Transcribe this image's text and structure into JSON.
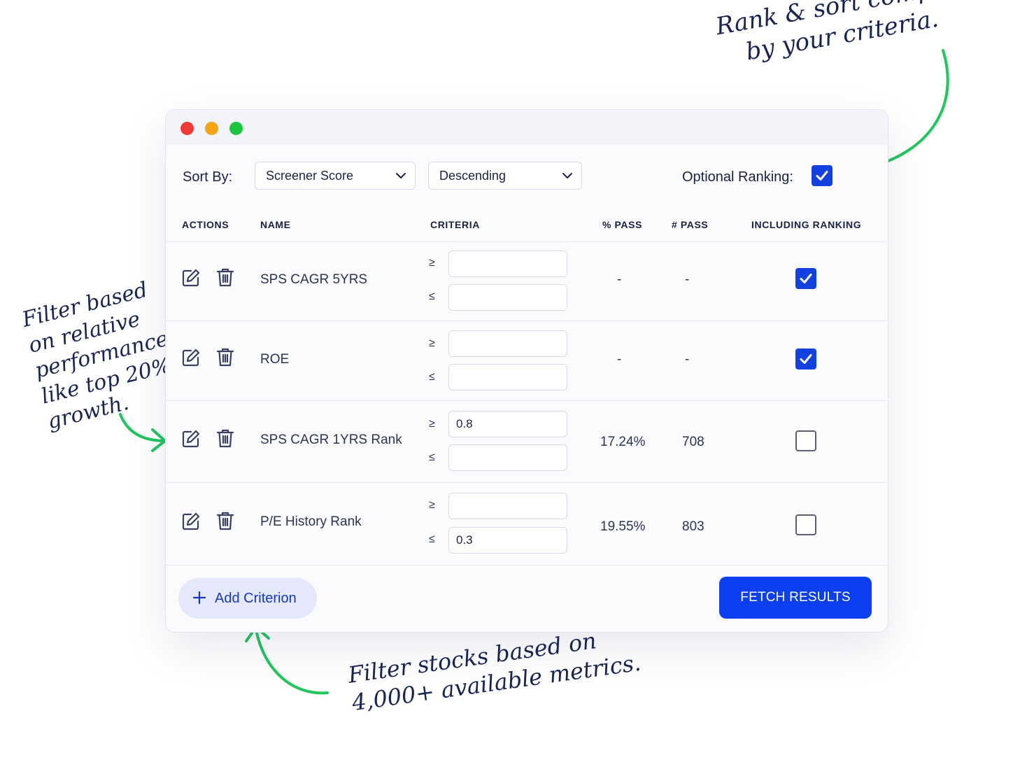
{
  "annotations": {
    "top_line1": "Rank & sort companies",
    "top_line2": "by your criteria.",
    "left_line1": "Filter based",
    "left_line2": "on relative",
    "left_line3": "performance,",
    "left_line4": "like top 20%",
    "left_line5": "growth.",
    "bottom_line1": "Filter stocks based on",
    "bottom_line2": "4,000+ available metrics."
  },
  "window": {
    "traffic_lights": {
      "close_color": "#ef3b35",
      "minimize_color": "#f6a417",
      "zoom_color": "#1ec53f"
    }
  },
  "sortbar": {
    "sort_label": "Sort By:",
    "sort_field": "Screener Score",
    "sort_direction": "Descending",
    "optional_ranking_label": "Optional Ranking:",
    "optional_ranking_checked": true
  },
  "table": {
    "headers": {
      "actions": "ACTIONS",
      "name": "NAME",
      "criteria": "CRITERIA",
      "pct_pass": "% PASS",
      "num_pass": "# PASS",
      "including_ranking": "INCLUDING RANKING"
    },
    "operators": {
      "gte": "≥",
      "lte": "≤"
    },
    "rows": [
      {
        "name": "SPS CAGR 5YRS",
        "min": "",
        "max": "",
        "pct_pass": "-",
        "num_pass": "-",
        "include_ranking": true
      },
      {
        "name": "ROE",
        "min": "",
        "max": "",
        "pct_pass": "-",
        "num_pass": "-",
        "include_ranking": true
      },
      {
        "name": "SPS CAGR 1YRS Rank",
        "min": "0.8",
        "max": "",
        "pct_pass": "17.24%",
        "num_pass": "708",
        "include_ranking": false
      },
      {
        "name": "P/E History Rank",
        "min": "",
        "max": "0.3",
        "pct_pass": "19.55%",
        "num_pass": "803",
        "include_ranking": false
      }
    ]
  },
  "footer": {
    "add_label": "Add Criterion",
    "fetch_label": "FETCH RESULTS"
  },
  "colors": {
    "accent": "#0b3ff0",
    "checkbox_on": "#1241e0",
    "annotation_arrow": "#22c55e",
    "annotation_text": "#1a2450"
  }
}
